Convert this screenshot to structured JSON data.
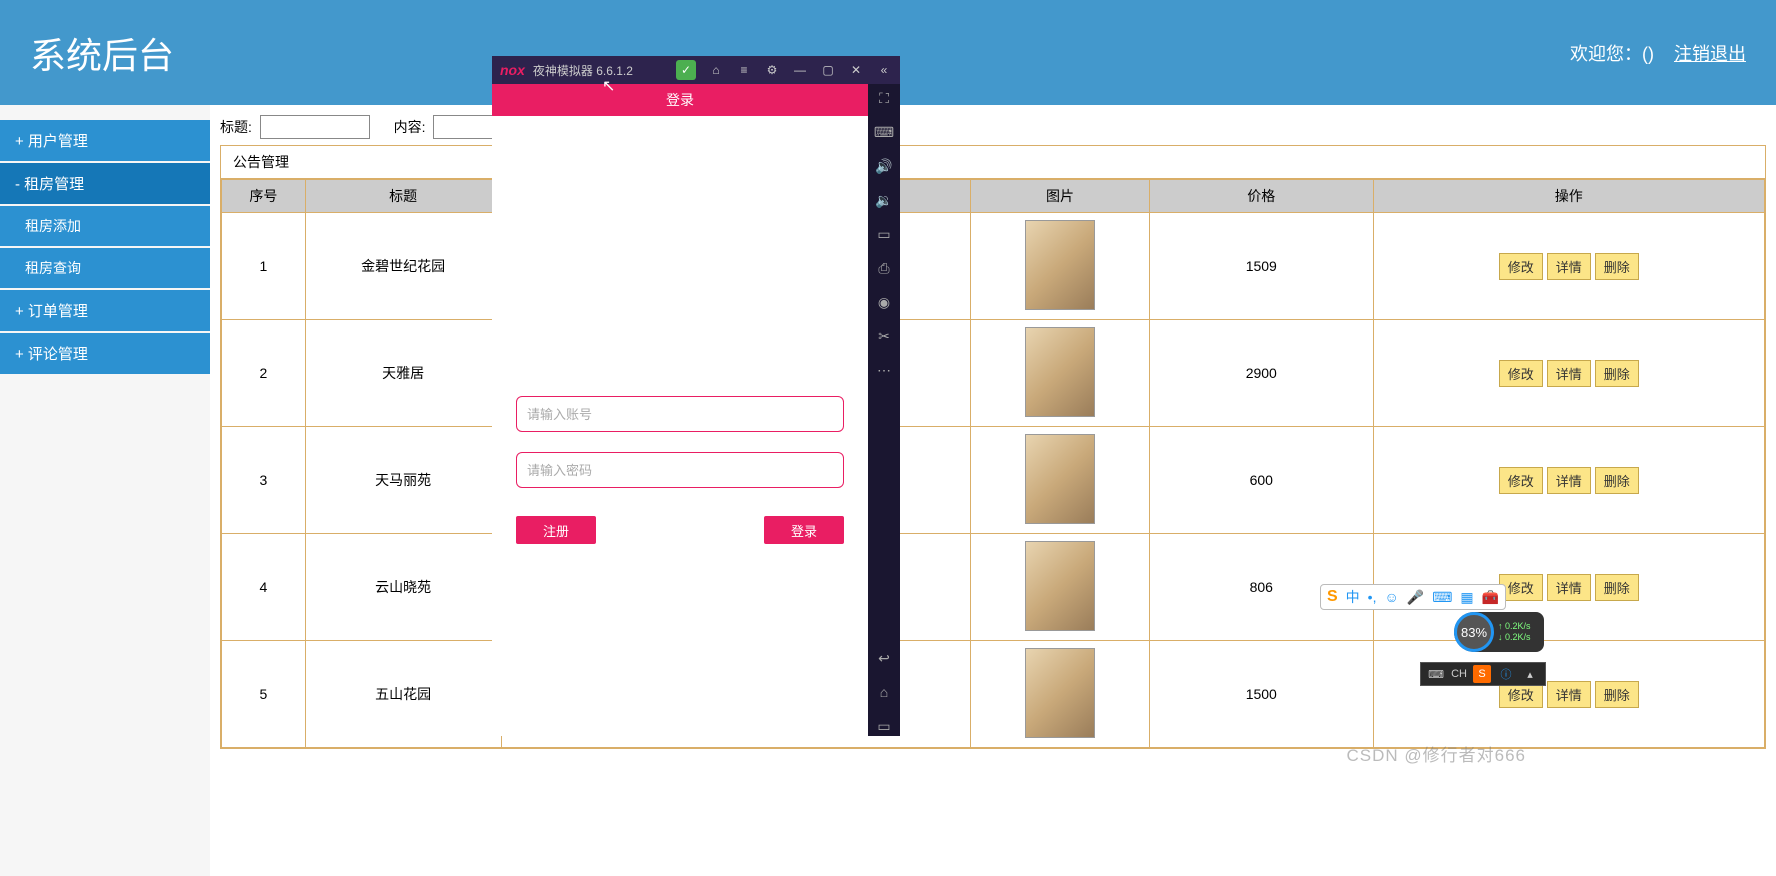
{
  "header": {
    "title": "系统后台",
    "welcome": "欢迎您：()",
    "logout": "注销退出"
  },
  "sidebar": {
    "items": [
      {
        "label": "+  用户管理"
      },
      {
        "label": "-  租房管理",
        "active": true,
        "children": [
          {
            "label": "租房添加"
          },
          {
            "label": "租房查询"
          }
        ]
      },
      {
        "label": "+  订单管理"
      },
      {
        "label": "+  评论管理"
      }
    ]
  },
  "filter": {
    "title_label": "标题:",
    "content_label": "内容:"
  },
  "panel": {
    "title": "公告管理"
  },
  "table": {
    "headers": {
      "seq": "序号",
      "title": "标题",
      "img": "图片",
      "price": "价格",
      "ops": "操作"
    },
    "ops": {
      "edit": "修改",
      "detail": "详情",
      "del": "删除"
    },
    "rows": [
      {
        "seq": "1",
        "title": "金碧世纪花园",
        "price": "1509"
      },
      {
        "seq": "2",
        "title": "天雅居",
        "price": "2900"
      },
      {
        "seq": "3",
        "title": "天马丽苑",
        "price": "600"
      },
      {
        "seq": "4",
        "title": "云山晓苑",
        "price": "806"
      },
      {
        "seq": "5",
        "title": "五山花园",
        "price": "1500"
      }
    ]
  },
  "emulator": {
    "window_title": "夜神模拟器 6.6.1.2",
    "app_title": "登录",
    "username_placeholder": "请输入账号",
    "password_placeholder": "请输入密码",
    "register_btn": "注册",
    "login_btn": "登录"
  },
  "net": {
    "percent": "83%",
    "up": "0.2K/s",
    "down": "0.2K/s"
  },
  "ime": {
    "lang": "中"
  },
  "taskbar": {
    "ch": "CH"
  },
  "watermark": "CSDN @修行者对666"
}
